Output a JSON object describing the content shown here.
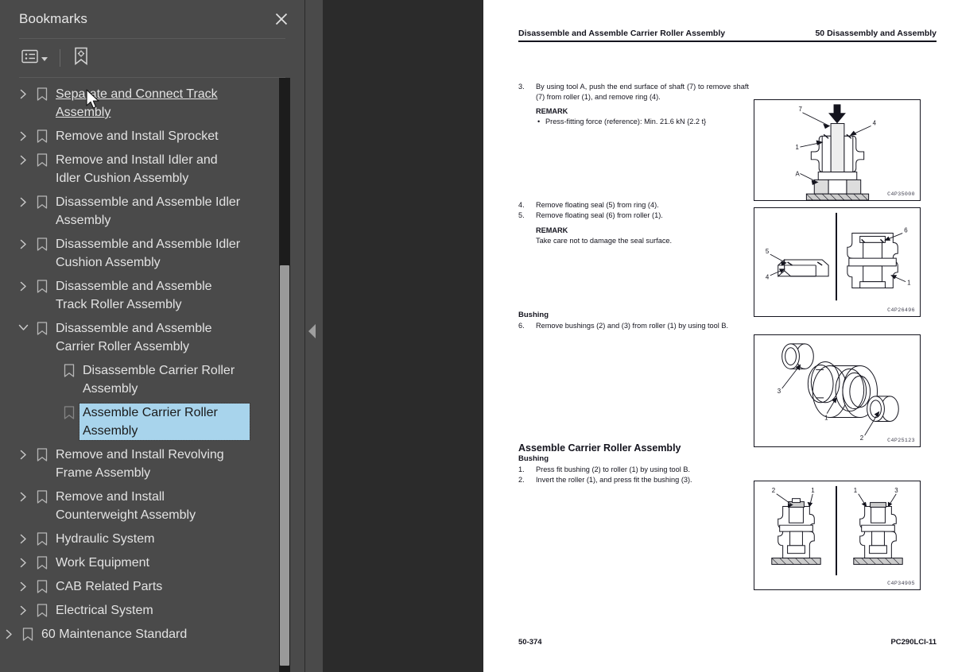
{
  "panel": {
    "title": "Bookmarks",
    "close_icon": "close-icon",
    "toolbar": {
      "list_options_icon": "list-options-icon",
      "expand_caret_icon": "chevron-down-icon",
      "new_bookmark_icon": "bookmark-settings-icon"
    },
    "bookmarks": [
      {
        "label": "Separate and Connect Track Assembly",
        "level": 1,
        "expandable": true,
        "expanded": false,
        "state": "hovered"
      },
      {
        "label": "Remove and Install Sprocket",
        "level": 1,
        "expandable": true,
        "expanded": false,
        "state": "normal"
      },
      {
        "label": "Remove and Install Idler and Idler Cushion Assembly",
        "level": 1,
        "expandable": true,
        "expanded": false,
        "state": "normal"
      },
      {
        "label": "Disassemble and Assemble Idler Assembly",
        "level": 1,
        "expandable": true,
        "expanded": false,
        "state": "normal"
      },
      {
        "label": "Disassemble and Assemble Idler Cushion Assembly",
        "level": 1,
        "expandable": true,
        "expanded": false,
        "state": "normal"
      },
      {
        "label": "Disassemble and Assemble Track Roller Assembly",
        "level": 1,
        "expandable": true,
        "expanded": false,
        "state": "normal"
      },
      {
        "label": "Disassemble and Assemble Carrier Roller Assembly",
        "level": 1,
        "expandable": true,
        "expanded": true,
        "state": "normal"
      },
      {
        "label": "Disassemble Carrier Roller Assembly",
        "level": 2,
        "expandable": false,
        "expanded": false,
        "state": "normal"
      },
      {
        "label": "Assemble Carrier Roller Assembly",
        "level": 2,
        "expandable": false,
        "expanded": false,
        "state": "selected"
      },
      {
        "label": "Remove and Install Revolving Frame Assembly",
        "level": 1,
        "expandable": true,
        "expanded": false,
        "state": "normal"
      },
      {
        "label": "Remove and Install Counterweight Assembly",
        "level": 1,
        "expandable": true,
        "expanded": false,
        "state": "normal"
      },
      {
        "label": "Hydraulic System",
        "level": 0,
        "expandable": true,
        "expanded": false,
        "state": "normal"
      },
      {
        "label": "Work Equipment",
        "level": 0,
        "expandable": true,
        "expanded": false,
        "state": "normal"
      },
      {
        "label": "CAB Related Parts",
        "level": 0,
        "expandable": true,
        "expanded": false,
        "state": "normal"
      },
      {
        "label": "Electrical System",
        "level": 0,
        "expandable": true,
        "expanded": false,
        "state": "normal"
      },
      {
        "label": "60 Maintenance Standard",
        "level": -1,
        "expandable": true,
        "expanded": false,
        "state": "normal"
      }
    ],
    "colors": {
      "panel_bg": "#4a4a4a",
      "text": "#e3e3e3",
      "selection_bg": "#a8d4ec",
      "selection_text": "#1a1a1a",
      "scrollbar_thumb": "#9a9a9a"
    }
  },
  "viewer": {
    "collapse_handle_icon": "caret-left-icon"
  },
  "document": {
    "header_left": "Disassemble and Assemble Carrier Roller Assembly",
    "header_right": "50 Disassembly and Assembly",
    "footer_left": "50-374",
    "footer_right": "PC290LCI-11",
    "steps": [
      {
        "num": "3.",
        "text": "By using tool A, push the end surface of shaft (7) to remove shaft (7) from roller (1), and remove ring (4)."
      },
      {
        "num": "4.",
        "text": "Remove floating seal (5) from ring (4)."
      },
      {
        "num": "5.",
        "text": "Remove floating seal (6) from roller (1)."
      },
      {
        "num": "6.",
        "text": "Remove bushings (2) and (3) from roller (1) by using tool B."
      }
    ],
    "remark1_heading": "REMARK",
    "remark1_bullet": "Press-fitting force (reference): Min. 21.6 kN {2.2 t}",
    "remark2_heading": "REMARK",
    "remark2_text": "Take care not to damage the seal surface.",
    "bushing_heading_1": "Bushing",
    "assemble_heading": "Assemble Carrier Roller Assembly",
    "bushing_heading_2": "Bushing",
    "assemble_steps": [
      {
        "num": "1.",
        "text": "Press fit bushing (2) to roller (1) by using tool B."
      },
      {
        "num": "2.",
        "text": "Invert the roller (1), and press fit the bushing (3)."
      }
    ],
    "figures": [
      {
        "code": "C4P35000",
        "caption_labels": [
          "7",
          "4",
          "1",
          "A"
        ]
      },
      {
        "code": "C4P26496",
        "caption_labels": [
          "5",
          "4",
          "6",
          "1"
        ]
      },
      {
        "code": "C4P25123",
        "caption_labels": [
          "3",
          "1",
          "2"
        ]
      },
      {
        "code": "C4P34905",
        "caption_labels": [
          "2",
          "1",
          "1",
          "3"
        ]
      }
    ]
  }
}
